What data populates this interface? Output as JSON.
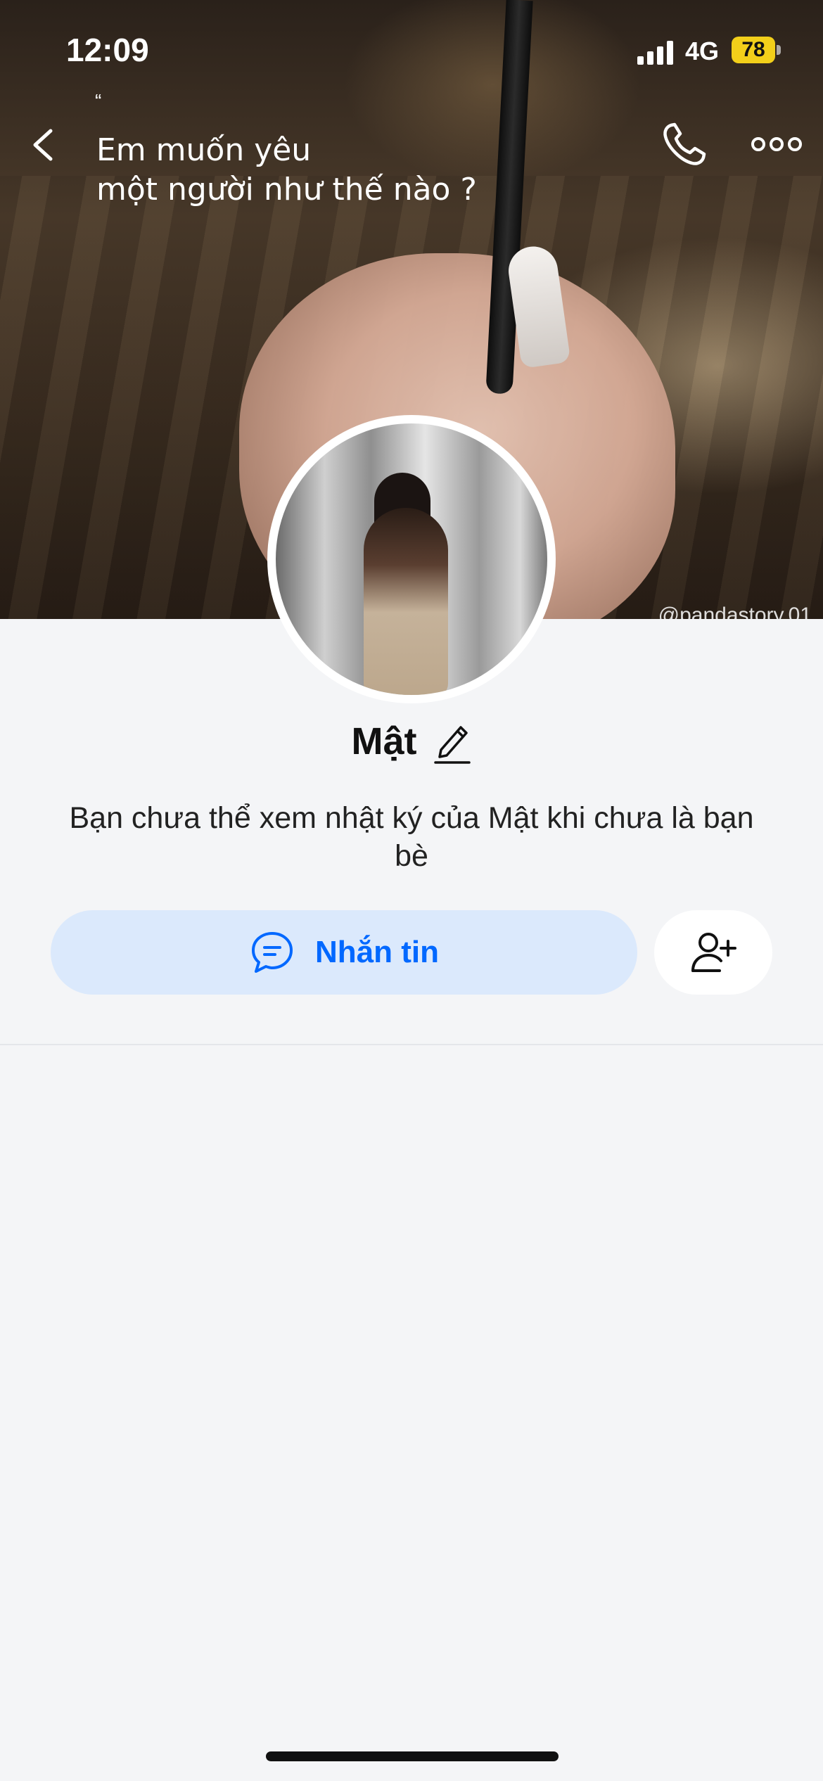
{
  "status_bar": {
    "time": "12:09",
    "network": "4G",
    "battery": "78"
  },
  "cover": {
    "quote_mark": "“",
    "quote_line1": "Em muốn yêu",
    "quote_line2": "một người như thế nào ?",
    "watermark": "@pandastory.01"
  },
  "profile": {
    "name": "Mật",
    "description": "Bạn chưa thể xem nhật ký của Mật khi chưa là bạn bè"
  },
  "actions": {
    "message_label": "Nhắn tin"
  },
  "colors": {
    "accent": "#0068ff",
    "accent_bg": "#dbe9fc",
    "battery": "#f2cf1a",
    "page_bg": "#f4f5f7"
  }
}
